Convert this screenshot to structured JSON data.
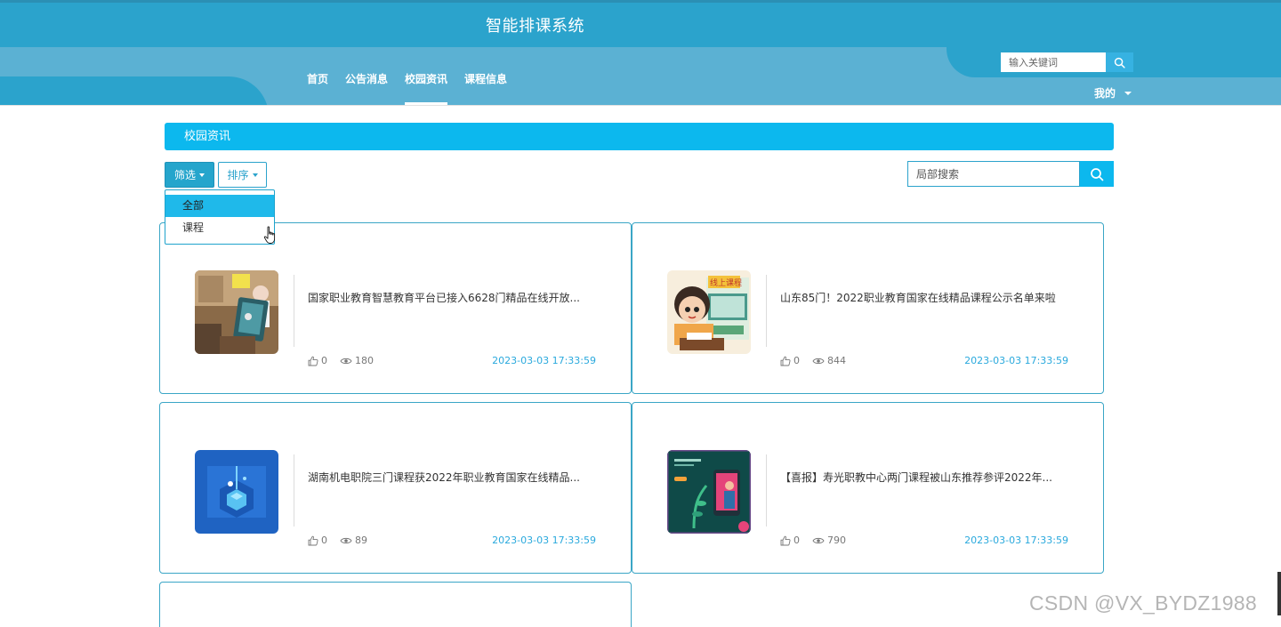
{
  "header": {
    "site_title": "智能排课系统",
    "nav": [
      {
        "label": "首页",
        "active": false
      },
      {
        "label": "公告消息",
        "active": false
      },
      {
        "label": "校园资讯",
        "active": true
      },
      {
        "label": "课程信息",
        "active": false
      }
    ],
    "search_placeholder": "输入关键词",
    "search_icon": "search-icon",
    "user_menu_label": "我的"
  },
  "section": {
    "title": "校园资讯"
  },
  "toolbar": {
    "filter_label": "筛选",
    "sort_label": "排序",
    "filter_options": [
      {
        "label": "全部",
        "selected": true
      },
      {
        "label": "课程",
        "selected": false
      }
    ],
    "local_search_placeholder": "局部搜索"
  },
  "news": [
    {
      "title": "国家职业教育智慧教育平台已接入6628门精品在线开放...",
      "likes": "0",
      "views": "180",
      "date": "2023-03-03 17:33:59"
    },
    {
      "title": "山东85门！2022职业教育国家在线精品课程公示名单来啦",
      "likes": "0",
      "views": "844",
      "date": "2023-03-03 17:33:59"
    },
    {
      "title": "湖南机电职院三门课程获2022年职业教育国家在线精品...",
      "likes": "0",
      "views": "89",
      "date": "2023-03-03 17:33:59"
    },
    {
      "title": "【喜报】寿光职教中心两门课程被山东推荐参评2022年...",
      "likes": "0",
      "views": "790",
      "date": "2023-03-03 17:33:59"
    }
  ],
  "thumb_labels": {
    "course_online": "线上课程"
  },
  "watermark": "CSDN @VX_BYDZ1988",
  "colors": {
    "primary": "#2ba3cc",
    "accent": "#0cb8ee",
    "header_light": "#5bb1d3",
    "date_text": "#2aa9dd"
  }
}
